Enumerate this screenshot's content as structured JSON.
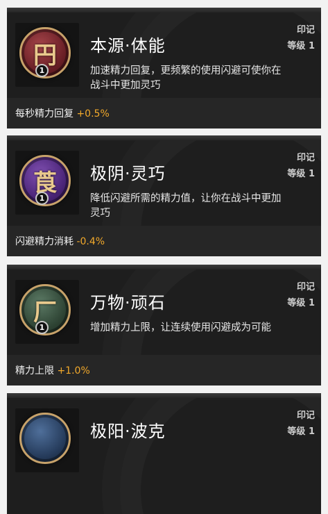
{
  "cards": [
    {
      "title": "本源·体能",
      "description": "加速精力回复，更频繁的使用闪避可使你在战斗中更加灵巧",
      "type_label": "印记",
      "level_label": "等级 1",
      "stat_label": "每秒精力回复",
      "stat_value": "+0.5%",
      "rank": "1",
      "glyph": "円",
      "icon_color": "red",
      "icon_name": "origin-stamina-medal-icon"
    },
    {
      "title": "极阴·灵巧",
      "description": "降低闪避所需的精力值，让你在战斗中更加灵巧",
      "type_label": "印记",
      "level_label": "等级 1",
      "stat_label": "闪避精力消耗",
      "stat_value": "-0.4%",
      "rank": "1",
      "glyph": "莨",
      "icon_color": "purple",
      "icon_name": "yin-agility-medal-icon"
    },
    {
      "title": "万物·顽石",
      "description": "增加精力上限，让连续使用闪避成为可能",
      "type_label": "印记",
      "level_label": "等级 1",
      "stat_label": "精力上限",
      "stat_value": "+1.0%",
      "rank": "1",
      "glyph": "厂",
      "icon_color": "green",
      "icon_name": "stone-medal-icon"
    },
    {
      "title": "极阳·波克",
      "type_label": "印记",
      "level_label": "等级 1",
      "icon_color": "blue",
      "icon_name": "yang-medal-icon"
    }
  ],
  "colors": {
    "stat_value": "#f2a92b",
    "card_bg": "#1e1e1e",
    "medal_rim": "#c7a26a"
  }
}
